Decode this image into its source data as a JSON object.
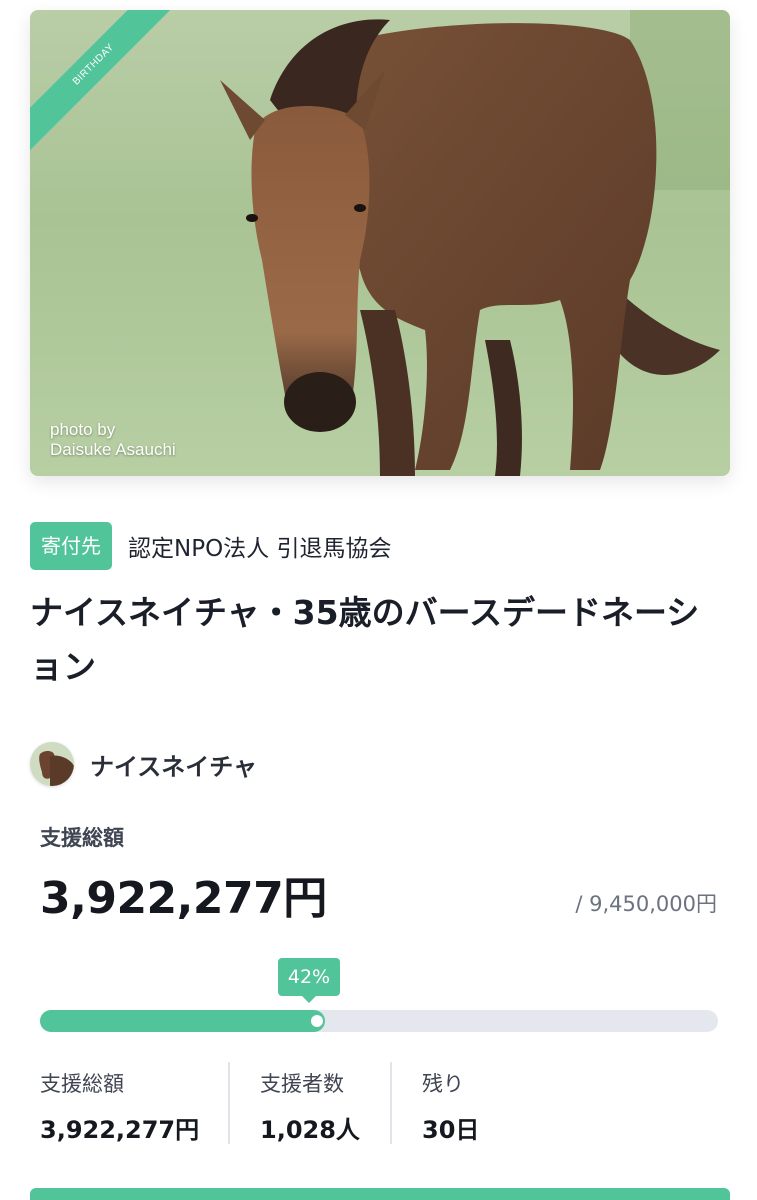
{
  "hero": {
    "ribbon": "BIRTHDAY",
    "credit_line1": "photo by",
    "credit_line2": "Daisuke Asauchi"
  },
  "project": {
    "tag": "寄付先",
    "org": "認定NPO法人 引退馬協会",
    "title": "ナイスネイチャ・35歳のバースデードネーション"
  },
  "owner": {
    "name": "ナイスネイチャ"
  },
  "funding": {
    "total_label": "支援総額",
    "total": "3,922,277円",
    "goal": "/ 9,450,000円",
    "percent_label": "42%",
    "progress": 0.42
  },
  "stats": [
    {
      "label": "支援総額",
      "value": "3,922,277円"
    },
    {
      "label": "支援者数",
      "value": "1,028人"
    },
    {
      "label": "残り",
      "value": "30日"
    }
  ],
  "colors": {
    "accent": "#52c49a",
    "track": "#e4e8ee"
  }
}
